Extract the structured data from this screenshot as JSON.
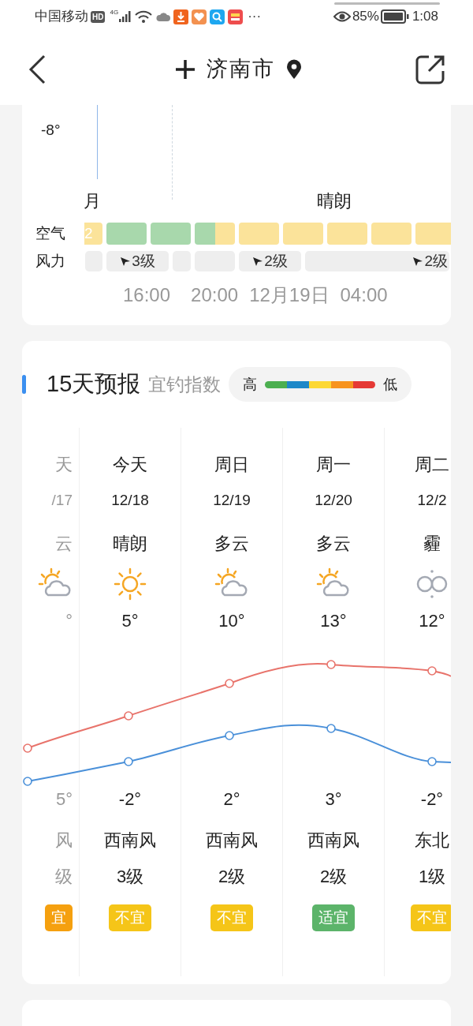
{
  "status_bar": {
    "carrier": "中国移动",
    "hd": "HD",
    "network": "4G",
    "more": "···",
    "battery": "85%",
    "time": "1:08"
  },
  "header": {
    "city": "济南市"
  },
  "hourly": {
    "temp_label": "-8°",
    "conditions": [
      "月",
      "晴朗"
    ],
    "air_label": "空气",
    "wind_label": "风力",
    "air": [
      {
        "text": "2",
        "color": "#fbe39a"
      },
      {
        "color": "#a8d8ac"
      },
      {
        "color": "#a8d8ac"
      },
      {
        "color": "#a8d8ac",
        "kind": "half_left"
      },
      {
        "color": "#fbe39a",
        "kind": "half_right"
      },
      {
        "color": "#fbe39a"
      },
      {
        "color": "#fbe39a"
      },
      {
        "color": "#fbe39a"
      },
      {
        "color": "#fbe39a"
      },
      {
        "color": "#fbe39a"
      }
    ],
    "wind": [
      {
        "text": "3级"
      },
      {
        "text": "2级"
      },
      {
        "text": "2级"
      }
    ],
    "times": [
      "16:00",
      "20:00",
      "12月19日",
      "04:00"
    ]
  },
  "forecast": {
    "title": "15天预报",
    "subtitle": "宜钓指数",
    "legend_high": "高",
    "legend_low": "低",
    "days": [
      {
        "day": "天",
        "date": "/17",
        "cond": "云",
        "kind": "partly_cloudy",
        "high": "°",
        "low": "5°",
        "wind_dir": "风",
        "wind_level": "级",
        "badge": "宜",
        "color": "#f5a00f",
        "past": true
      },
      {
        "day": "今天",
        "date": "12/18",
        "cond": "晴朗",
        "kind": "sunny",
        "high": "5°",
        "low": "-2°",
        "wind_dir": "西南风",
        "wind_level": "3级",
        "badge": "不宜",
        "color": "#f5c518",
        "past": false
      },
      {
        "day": "周日",
        "date": "12/19",
        "cond": "多云",
        "kind": "partly_cloudy",
        "high": "10°",
        "low": "2°",
        "wind_dir": "西南风",
        "wind_level": "2级",
        "badge": "不宜",
        "color": "#f5c518",
        "past": false
      },
      {
        "day": "周一",
        "date": "12/20",
        "cond": "多云",
        "kind": "partly_cloudy",
        "high": "13°",
        "low": "3°",
        "wind_dir": "西南风",
        "wind_level": "2级",
        "badge": "适宜",
        "color": "#5cb46a",
        "past": false
      },
      {
        "day": "周二",
        "date": "12/2",
        "cond": "霾",
        "kind": "haze",
        "high": "12°",
        "low": "-2°",
        "wind_dir": "东北",
        "wind_level": "1级",
        "badge": "不宜",
        "color": "#f5c518",
        "past": false
      }
    ]
  }
}
